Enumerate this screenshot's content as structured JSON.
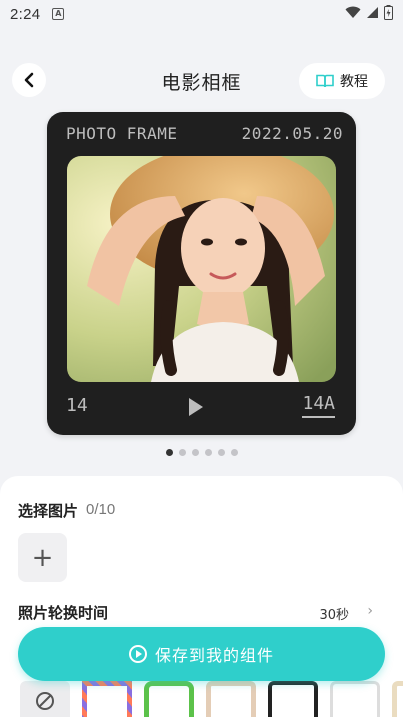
{
  "status": {
    "time": "2:24",
    "notif_letter": "A"
  },
  "nav": {
    "title": "电影相框",
    "tutorial_label": "教程"
  },
  "frame": {
    "title": "PHOTO FRAME",
    "date": "2022.05.20",
    "left_number": "14",
    "right_number": "14A"
  },
  "pager": {
    "total": 6,
    "active_index": 0
  },
  "panel": {
    "select_label": "选择图片",
    "select_count": "0/10",
    "add_symbol": "+",
    "rotate_label": "照片轮换时间",
    "rotate_value": "30秒",
    "chevron": "›"
  },
  "save_button": {
    "label": "保存到我的组件"
  },
  "thumbnails": [
    {
      "style": "none"
    },
    {
      "style": "stripe"
    },
    {
      "style": "leaf"
    },
    {
      "style": "wood"
    },
    {
      "style": "black"
    },
    {
      "style": "gray"
    },
    {
      "style": "beige"
    }
  ],
  "colors": {
    "accent": "#2fcfcb",
    "background": "#f2f3f6",
    "frame": "#1f1f1f"
  }
}
